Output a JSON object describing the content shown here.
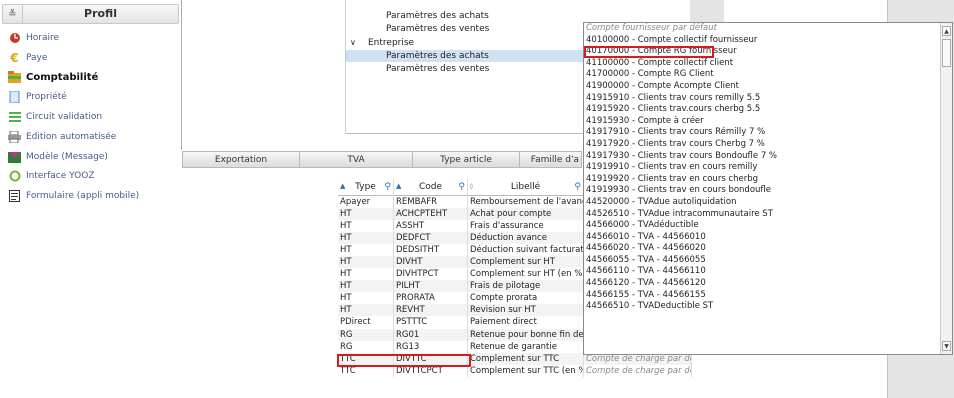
{
  "sidebar": {
    "title": "Profil",
    "collapse_icon": "double-chevron-down-icon",
    "items": [
      {
        "label": "Horaire",
        "icon": "clock-icon",
        "color": "#c0392b"
      },
      {
        "label": "Paye",
        "icon": "euro-icon",
        "color": "#e6a817"
      },
      {
        "label": "Comptabilité",
        "icon": "folder-icon",
        "color": "#e8a020"
      },
      {
        "label": "Propriété",
        "icon": "document-icon",
        "color": "#4a90d9"
      },
      {
        "label": "Circuit validation",
        "icon": "list-icon",
        "color": "#4caf50"
      },
      {
        "label": "Edition automatisée",
        "icon": "print-icon",
        "color": "#666666"
      },
      {
        "label": "Modèle (Message)",
        "icon": "envelope-icon",
        "color": "#b03a8a"
      },
      {
        "label": "Interface YOOZ",
        "icon": "sync-icon",
        "color": "#7cb342"
      },
      {
        "label": "Formulaire (appli mobile)",
        "icon": "form-icon",
        "color": "#333333"
      }
    ]
  },
  "tree": [
    {
      "label": "Paramètres des achats",
      "indent": 2,
      "selected": false
    },
    {
      "label": "Paramètres des ventes",
      "indent": 2,
      "selected": false
    },
    {
      "label": "Entreprise",
      "indent": 1,
      "selected": false,
      "expander": "∨"
    },
    {
      "label": "Paramètres des achats",
      "indent": 2,
      "selected": true
    },
    {
      "label": "Paramètres des ventes",
      "indent": 2,
      "selected": false
    }
  ],
  "tabs": [
    "Exportation",
    "TVA",
    "Type article",
    "Famille d'a"
  ],
  "grid": {
    "headers": [
      "Type",
      "Code",
      "Libellé",
      ""
    ],
    "rows": [
      [
        "Apayer",
        "REMBAFR",
        "Remboursement de l'avance..."
      ],
      [
        "HT",
        "ACHCPTEHT",
        "Achat pour compte"
      ],
      [
        "HT",
        "ASSHT",
        "Frais d'assurance"
      ],
      [
        "HT",
        "DEDFCT",
        "Déduction avance"
      ],
      [
        "HT",
        "DEDSITHT",
        "Déduction suivant facturat..."
      ],
      [
        "HT",
        "DIVHT",
        "Complement sur HT"
      ],
      [
        "HT",
        "DIVHTPCT",
        "Complement sur HT (en %)"
      ],
      [
        "HT",
        "PILHT",
        "Frais de pilotage"
      ],
      [
        "HT",
        "PRORATA",
        "Compte prorata"
      ],
      [
        "HT",
        "REVHT",
        "Revision sur HT"
      ],
      [
        "PDirect",
        "PSTTTC",
        "Paiement direct"
      ],
      [
        "RG",
        "RG01",
        "Retenue pour bonne fin de t..."
      ],
      [
        "RG",
        "RG13",
        "Retenue de garantie"
      ],
      [
        "TTC",
        "DIVTTC",
        "Complement sur TTC"
      ],
      [
        "TTC",
        "DIVTTCPCT",
        "Complement sur TTC (en %)"
      ]
    ],
    "combo_value": "40170000 - Compte RG fou",
    "placeholder": "Compte de charge par défaut"
  },
  "dropdown": {
    "items": [
      "Compte fournisseur par défaut",
      "40100000 - Compte collectif fournisseur",
      "40170000 - Compte RG fournisseur",
      "41100000 - Compte collectif client",
      "41700000 - Compte RG Client",
      "41900000 - Compte Acompte Client",
      "41915910 - Clients trav cours remilly 5.5",
      "41915920 - Clients trav.cours cherbg 5.5",
      "41915930 - Compte à créer",
      "41917910 - Clients trav cours Rémilly 7 %",
      "41917920 - Clients trav cours Cherbg 7 %",
      "41917930 - Clients trav cours Bondoufle 7 %",
      "41919910 - Clients trav en cours remilly",
      "41919920 - Clients trav en cours cherbg",
      "41919930 - Clients trav en cours bondoufle",
      "44520000 - TVAdue autoliquidation",
      "44526510 - TVAdue intracommunautaire ST",
      "44566000 - TVAdéductible",
      "44566010 - TVA - 44566010",
      "44566020 - TVA - 44566020",
      "44566055 - TVA - 44566055",
      "44566110 - TVA - 44566110",
      "44566120 - TVA - 44566120",
      "44566155 - TVA - 44566155",
      "44566510 - TVADeductible ST"
    ]
  },
  "colors": {
    "highlight": "#d21d1d",
    "selection": "#cfe1f3",
    "accent": "#2a6fb6"
  }
}
